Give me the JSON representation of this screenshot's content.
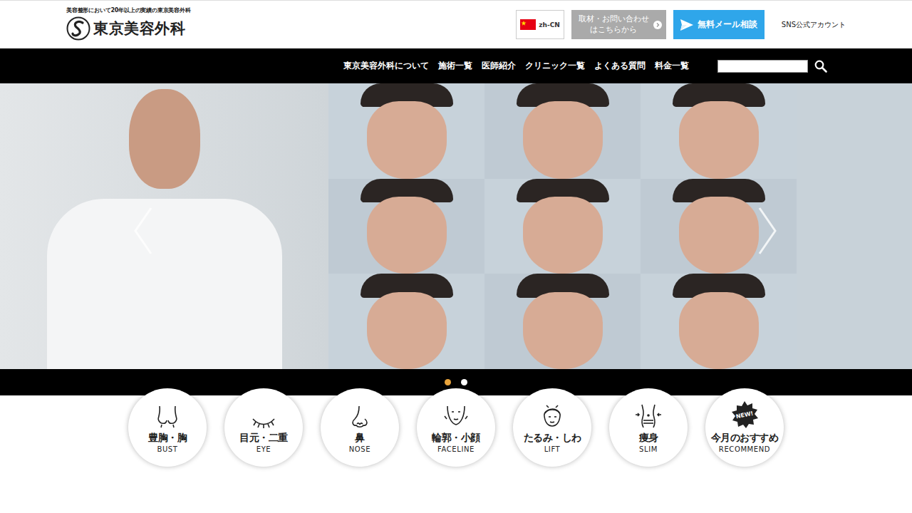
{
  "header": {
    "tagline": "美容整形において20年以上の実績の東京美容外科",
    "logo": "東京美容外科",
    "language": {
      "label": "zh-CN"
    },
    "press_button": {
      "lines": [
        "取材・お問い合わせ",
        "はこちらから"
      ]
    },
    "mail_button": {
      "label": "無料メール相談"
    },
    "sns_link": "SNS公式アカウント"
  },
  "nav": {
    "items": [
      "東京美容外科について",
      "施術一覧",
      "医師紹介",
      "クリニック一覧",
      "よくある質問",
      "料金一覧"
    ]
  },
  "carousel": {
    "slides": [
      {
        "selected": true
      },
      {
        "selected": false
      }
    ]
  },
  "categories": [
    {
      "label": "豊胸・胸",
      "sub": "BUST"
    },
    {
      "label": "目元・二重",
      "sub": "EYE"
    },
    {
      "label": "鼻",
      "sub": "NOSE"
    },
    {
      "label": "輪郭・小顔",
      "sub": "FACELINE"
    },
    {
      "label": "たるみ・しわ",
      "sub": "LIFT"
    },
    {
      "label": "痩身",
      "sub": "SLIM"
    },
    {
      "label": "今月のおすすめ",
      "sub": "RECOMMEND",
      "badge": "NEW!"
    }
  ]
}
